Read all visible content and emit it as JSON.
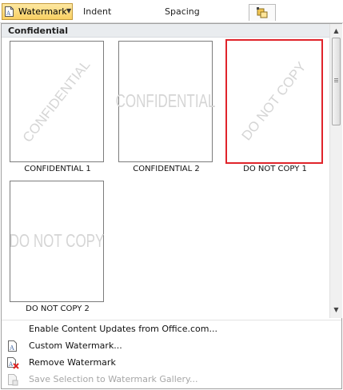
{
  "ribbon": {
    "watermark_button": "Watermark",
    "indent_tab": "Indent",
    "spacing_tab": "Spacing"
  },
  "panel": {
    "section_title": "Confidential",
    "thumbnails": [
      {
        "caption": "CONFIDENTIAL 1",
        "text": "CONFIDENTIAL",
        "style": "diagonal",
        "selected": false
      },
      {
        "caption": "CONFIDENTIAL 2",
        "text": "CONFIDENTIAL",
        "style": "horizontal",
        "selected": false
      },
      {
        "caption": "DO NOT COPY 1",
        "text": "DO NOT COPY",
        "style": "diagonal",
        "selected": true
      },
      {
        "caption": "DO NOT COPY 2",
        "text": "DO NOT COPY",
        "style": "horizontal",
        "selected": false
      }
    ],
    "selection_color": "#e0242b"
  },
  "menu": {
    "enable_updates": "Enable Content Updates from Office.com...",
    "custom_watermark": "Custom Watermark...",
    "remove_watermark": "Remove Watermark",
    "save_selection": "Save Selection to Watermark Gallery..."
  }
}
